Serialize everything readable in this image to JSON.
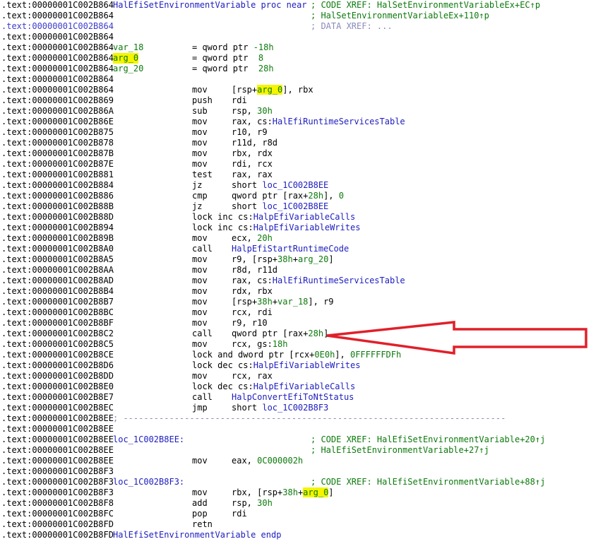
{
  "lines": [
    {
      "addr": ".text:00000001C002B864",
      "label": "HalEfiSetEnvironmentVariable proc near",
      "label_color": "blue",
      "comment": "; CODE XREF: HalSetEnvironmentVariableEx+EC↑p"
    },
    {
      "addr": ".text:00000001C002B864",
      "comment": "; HalSetEnvironmentVariableEx+110↑p"
    },
    {
      "addr": ".text:00000001C002B864",
      "addr_color": "blue",
      "comment": "; DATA XREF: ...",
      "comment_style": "gray"
    },
    {
      "addr": ".text:00000001C002B864"
    },
    {
      "addr": ".text:00000001C002B864",
      "label": "var_18",
      "label_color": "green",
      "operands": [
        {
          "t": "= qword ptr "
        },
        {
          "t": "-18h",
          "c": "green"
        }
      ],
      "ops_col": "mn"
    },
    {
      "addr": ".text:00000001C002B864",
      "label": "arg_0",
      "label_color": "green",
      "label_hl": true,
      "operands": [
        {
          "t": "= qword ptr  "
        },
        {
          "t": "8",
          "c": "green"
        }
      ],
      "ops_col": "mn"
    },
    {
      "addr": ".text:00000001C002B864",
      "label": "arg_20",
      "label_color": "green",
      "operands": [
        {
          "t": "= qword ptr  "
        },
        {
          "t": "28h",
          "c": "green"
        }
      ],
      "ops_col": "mn"
    },
    {
      "addr": ".text:00000001C002B864"
    },
    {
      "addr": ".text:00000001C002B864",
      "mnemonic": "mov",
      "operands": [
        {
          "t": "[rsp+"
        },
        {
          "t": "arg_0",
          "c": "green",
          "hl": true
        },
        {
          "t": "], rbx"
        }
      ]
    },
    {
      "addr": ".text:00000001C002B869",
      "mnemonic": "push",
      "operands": [
        {
          "t": "rdi"
        }
      ]
    },
    {
      "addr": ".text:00000001C002B86A",
      "mnemonic": "sub",
      "operands": [
        {
          "t": "rsp, "
        },
        {
          "t": "30h",
          "c": "green"
        }
      ]
    },
    {
      "addr": ".text:00000001C002B86E",
      "mnemonic": "mov",
      "operands": [
        {
          "t": "rax, cs:"
        },
        {
          "t": "HalEfiRuntimeServicesTable",
          "c": "blue"
        }
      ]
    },
    {
      "addr": ".text:00000001C002B875",
      "mnemonic": "mov",
      "operands": [
        {
          "t": "r10, r9"
        }
      ]
    },
    {
      "addr": ".text:00000001C002B878",
      "mnemonic": "mov",
      "operands": [
        {
          "t": "r11d, r8d"
        }
      ]
    },
    {
      "addr": ".text:00000001C002B87B",
      "mnemonic": "mov",
      "operands": [
        {
          "t": "rbx, rdx"
        }
      ]
    },
    {
      "addr": ".text:00000001C002B87E",
      "mnemonic": "mov",
      "operands": [
        {
          "t": "rdi, rcx"
        }
      ]
    },
    {
      "addr": ".text:00000001C002B881",
      "mnemonic": "test",
      "operands": [
        {
          "t": "rax, rax"
        }
      ]
    },
    {
      "addr": ".text:00000001C002B884",
      "mnemonic": "jz",
      "operands": [
        {
          "t": "short "
        },
        {
          "t": "loc_1C002B8EE",
          "c": "blue"
        }
      ]
    },
    {
      "addr": ".text:00000001C002B886",
      "mnemonic": "cmp",
      "operands": [
        {
          "t": "qword ptr [rax+"
        },
        {
          "t": "28h",
          "c": "green"
        },
        {
          "t": "], "
        },
        {
          "t": "0",
          "c": "green"
        }
      ]
    },
    {
      "addr": ".text:00000001C002B88B",
      "mnemonic": "jz",
      "operands": [
        {
          "t": "short "
        },
        {
          "t": "loc_1C002B8EE",
          "c": "blue"
        }
      ]
    },
    {
      "addr": ".text:00000001C002B88D",
      "mnemonic": "lock inc cs:",
      "mn_wide": true,
      "operands": [
        {
          "t": "lock inc cs:"
        },
        {
          "t": "HalpEfiVariableCalls",
          "c": "blue"
        }
      ]
    },
    {
      "addr": ".text:00000001C002B894",
      "mn_wide": true,
      "operands": [
        {
          "t": "lock inc cs:"
        },
        {
          "t": "HalpEfiVariableWrites",
          "c": "blue"
        }
      ]
    },
    {
      "addr": ".text:00000001C002B89B",
      "mnemonic": "mov",
      "operands": [
        {
          "t": "ecx, "
        },
        {
          "t": "20h",
          "c": "green"
        }
      ]
    },
    {
      "addr": ".text:00000001C002B8A0",
      "mnemonic": "call",
      "operands": [
        {
          "t": "HalpEfiStartRuntimeCode",
          "c": "blue"
        }
      ]
    },
    {
      "addr": ".text:00000001C002B8A5",
      "mnemonic": "mov",
      "operands": [
        {
          "t": "r9, [rsp+"
        },
        {
          "t": "38h",
          "c": "green"
        },
        {
          "t": "+"
        },
        {
          "t": "arg_20",
          "c": "green"
        },
        {
          "t": "]"
        }
      ]
    },
    {
      "addr": ".text:00000001C002B8AA",
      "mnemonic": "mov",
      "operands": [
        {
          "t": "r8d, r11d"
        }
      ]
    },
    {
      "addr": ".text:00000001C002B8AD",
      "mnemonic": "mov",
      "operands": [
        {
          "t": "rax, cs:"
        },
        {
          "t": "HalEfiRuntimeServicesTable",
          "c": "blue"
        }
      ]
    },
    {
      "addr": ".text:00000001C002B8B4",
      "mnemonic": "mov",
      "operands": [
        {
          "t": "rdx, rbx"
        }
      ]
    },
    {
      "addr": ".text:00000001C002B8B7",
      "mnemonic": "mov",
      "operands": [
        {
          "t": "[rsp+"
        },
        {
          "t": "38h",
          "c": "green"
        },
        {
          "t": "+"
        },
        {
          "t": "var_18",
          "c": "green"
        },
        {
          "t": "], r9"
        }
      ]
    },
    {
      "addr": ".text:00000001C002B8BC",
      "mnemonic": "mov",
      "operands": [
        {
          "t": "rcx, rdi"
        }
      ]
    },
    {
      "addr": ".text:00000001C002B8BF",
      "mnemonic": "mov",
      "operands": [
        {
          "t": "r9, r10"
        }
      ]
    },
    {
      "addr": ".text:00000001C002B8C2",
      "mnemonic": "call",
      "operands": [
        {
          "t": "qword ptr [rax+"
        },
        {
          "t": "28h",
          "c": "green"
        },
        {
          "t": "]"
        }
      ]
    },
    {
      "addr": ".text:00000001C002B8C5",
      "mnemonic": "mov",
      "operands": [
        {
          "t": "rcx, gs:"
        },
        {
          "t": "18h",
          "c": "green"
        }
      ]
    },
    {
      "addr": ".text:00000001C002B8CE",
      "mn_wide": true,
      "operands": [
        {
          "t": "lock and dword ptr [rcx+"
        },
        {
          "t": "0E0h",
          "c": "green"
        },
        {
          "t": "], "
        },
        {
          "t": "0FFFFFFDFh",
          "c": "green"
        }
      ]
    },
    {
      "addr": ".text:00000001C002B8D6",
      "mn_wide": true,
      "operands": [
        {
          "t": "lock dec cs:"
        },
        {
          "t": "HalpEfiVariableWrites",
          "c": "blue"
        }
      ]
    },
    {
      "addr": ".text:00000001C002B8DD",
      "mnemonic": "mov",
      "operands": [
        {
          "t": "rcx, rax"
        }
      ]
    },
    {
      "addr": ".text:00000001C002B8E0",
      "mn_wide": true,
      "operands": [
        {
          "t": "lock dec cs:"
        },
        {
          "t": "HalpEfiVariableCalls",
          "c": "blue"
        }
      ]
    },
    {
      "addr": ".text:00000001C002B8E7",
      "mnemonic": "call",
      "operands": [
        {
          "t": "HalpConvertEfiToNtStatus",
          "c": "blue"
        }
      ]
    },
    {
      "addr": ".text:00000001C002B8EC",
      "mnemonic": "jmp",
      "operands": [
        {
          "t": "short "
        },
        {
          "t": "loc_1C002B8F3",
          "c": "blue"
        }
      ]
    },
    {
      "addr": ".text:00000001C002B8EE",
      "separator": "; ---------------------------------------------------------------------------"
    },
    {
      "addr": ".text:00000001C002B8EE"
    },
    {
      "addr": ".text:00000001C002B8EE",
      "label": "loc_1C002B8EE:",
      "label_color": "blue",
      "comment": "; CODE XREF: HalEfiSetEnvironmentVariable+20↑j"
    },
    {
      "addr": ".text:00000001C002B8EE",
      "comment": "; HalEfiSetEnvironmentVariable+27↑j"
    },
    {
      "addr": ".text:00000001C002B8EE",
      "mnemonic": "mov",
      "operands": [
        {
          "t": "eax, "
        },
        {
          "t": "0C000002h",
          "c": "green"
        }
      ]
    },
    {
      "addr": ".text:00000001C002B8F3"
    },
    {
      "addr": ".text:00000001C002B8F3",
      "label": "loc_1C002B8F3:",
      "label_color": "blue",
      "comment": "; CODE XREF: HalEfiSetEnvironmentVariable+88↑j"
    },
    {
      "addr": ".text:00000001C002B8F3",
      "mnemonic": "mov",
      "operands": [
        {
          "t": "rbx, [rsp+"
        },
        {
          "t": "38h",
          "c": "green"
        },
        {
          "t": "+"
        },
        {
          "t": "arg_0",
          "c": "green",
          "hl": true
        },
        {
          "t": "]"
        }
      ]
    },
    {
      "addr": ".text:00000001C002B8F8",
      "mnemonic": "add",
      "operands": [
        {
          "t": "rsp, "
        },
        {
          "t": "30h",
          "c": "green"
        }
      ]
    },
    {
      "addr": ".text:00000001C002B8FC",
      "mnemonic": "pop",
      "operands": [
        {
          "t": "rdi"
        }
      ]
    },
    {
      "addr": ".text:00000001C002B8FD",
      "mnemonic": "retn"
    },
    {
      "addr": ".text:00000001C002B8FD",
      "label": "HalEfiSetEnvironmentVariable endp",
      "label_color": "blue"
    }
  ],
  "annotation": {
    "color": "#e0202a",
    "points_to_line": 31
  }
}
